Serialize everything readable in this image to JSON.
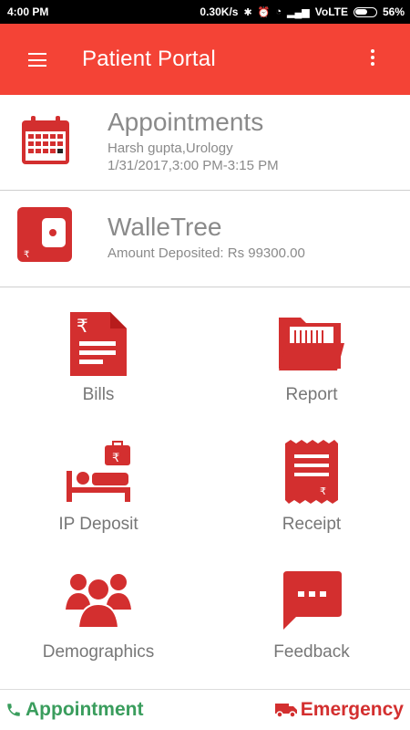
{
  "status_bar": {
    "time": "4:00 PM",
    "speed": "0.30K/s",
    "network": "VoLTE",
    "battery": "56%"
  },
  "app_bar": {
    "title": "Patient Portal"
  },
  "appointments": {
    "title": "Appointments",
    "doctor": "Harsh gupta,Urology",
    "datetime": "1/31/2017,3:00 PM-3:15 PM"
  },
  "wallet": {
    "title": "WalleTree",
    "amount": "Amount Deposited: Rs 99300.00"
  },
  "grid": {
    "bills": "Bills",
    "report": "Report",
    "ip_deposit": "IP Deposit",
    "receipt": "Receipt",
    "demographics": "Demographics",
    "feedback": "Feedback"
  },
  "bottom_bar": {
    "appointment": "Appointment",
    "emergency": "Emergency"
  },
  "colors": {
    "primary": "#f44336",
    "icon_red": "#d32f2f",
    "green": "#3a9d5d"
  }
}
